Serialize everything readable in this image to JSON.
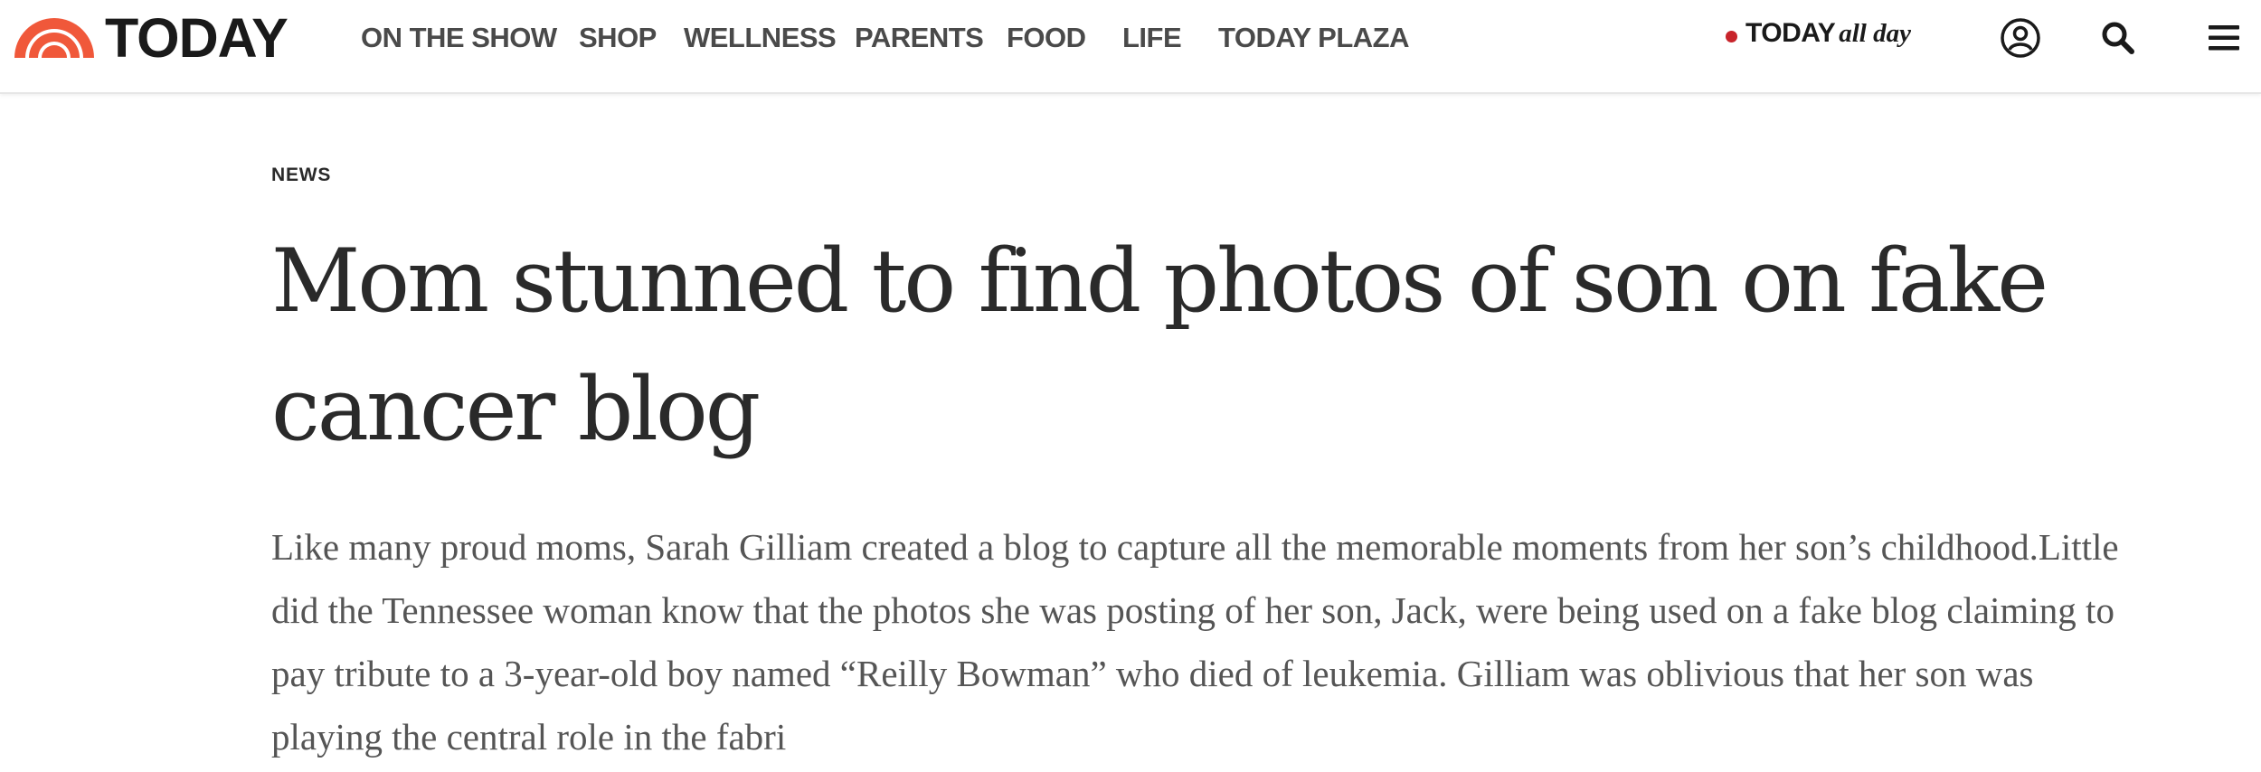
{
  "site": {
    "logo_text": "TODAY",
    "logo_icon": "rainbow-sunrise-icon",
    "brand_color": "#e15b3b",
    "live_dot_color": "#c8242b"
  },
  "nav": {
    "items": [
      {
        "label": "ON THE SHOW"
      },
      {
        "label": "SHOP"
      },
      {
        "label": "WELLNESS"
      },
      {
        "label": "PARENTS"
      },
      {
        "label": "FOOD"
      },
      {
        "label": "LIFE"
      },
      {
        "label": "TODAY PLAZA"
      }
    ]
  },
  "today_all_day": {
    "brand": "TODAY",
    "suffix": "all day"
  },
  "header_icons": {
    "account": "account-icon",
    "search": "search-icon",
    "menu": "hamburger-menu-icon"
  },
  "article": {
    "section": "NEWS",
    "headline": "Mom stunned to find photos of son on fake cancer blog",
    "dek": "Like many proud moms, Sarah Gilliam created a blog to capture all the memorable moments from her son’s childhood.Little did the Tennessee woman know that the photos she was posting of her son, Jack, were being used on a fake blog claiming to pay tribute to a 3-year-old boy named “Reilly Bowman” who died of leukemia. Gilliam was oblivious that her son was playing the central role in the fabri"
  }
}
